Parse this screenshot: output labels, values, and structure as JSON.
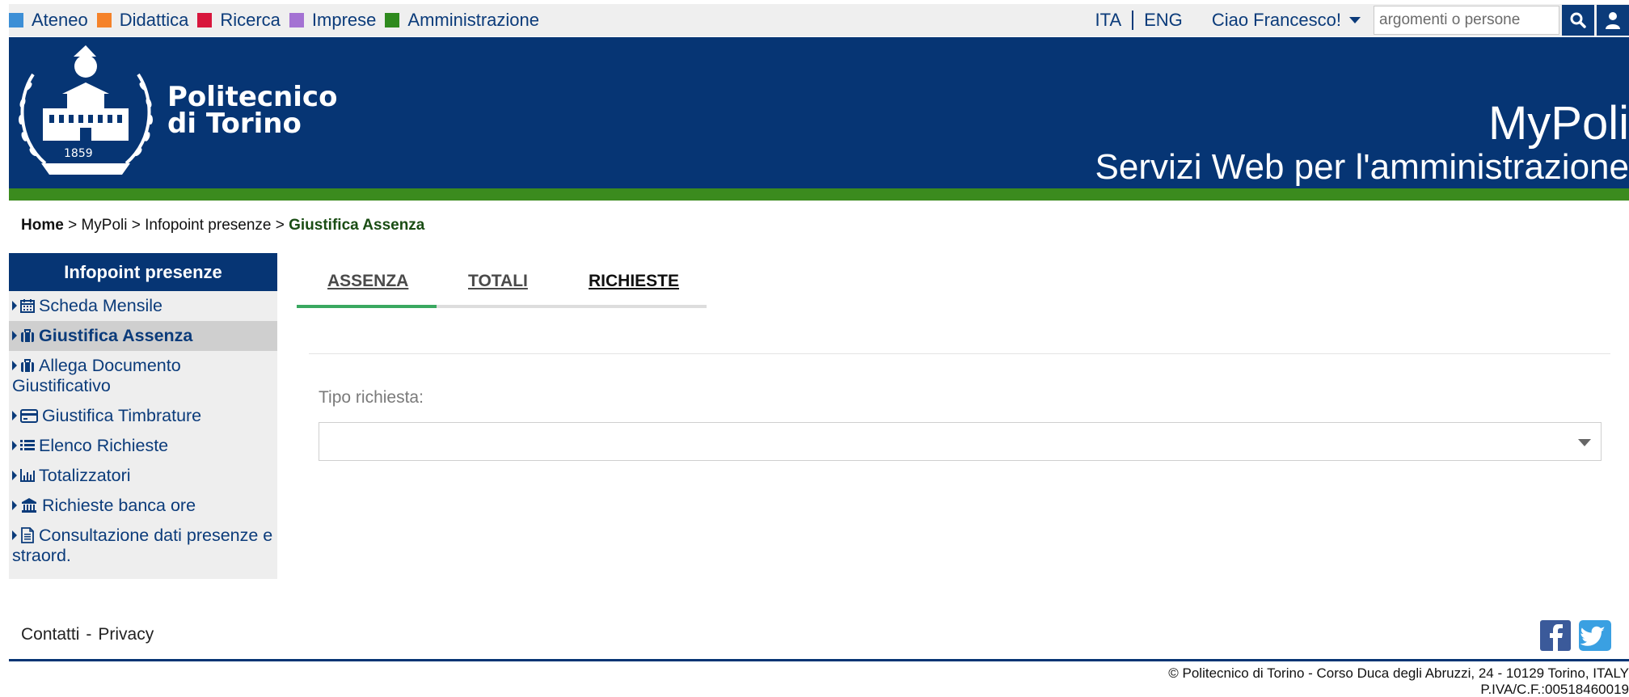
{
  "topnav": {
    "items": [
      {
        "label": "Ateneo",
        "color": "#3d8fd6"
      },
      {
        "label": "Didattica",
        "color": "#f5822a"
      },
      {
        "label": "Ricerca",
        "color": "#d8163c"
      },
      {
        "label": "Imprese",
        "color": "#a472d3"
      },
      {
        "label": "Amministrazione",
        "color": "#2f8a1e"
      }
    ],
    "lang_ita": "ITA",
    "lang_eng": "ENG",
    "user_greeting": "Ciao Francesco!",
    "search_placeholder": "argomenti o persone",
    "search_icon": "search-icon",
    "user_icon": "user-icon"
  },
  "header": {
    "logo_line1": "Politecnico",
    "logo_line2": "di Torino",
    "logo_year": "1859",
    "app_title": "MyPoli",
    "app_subtitle": "Servizi Web per l'amministrazione",
    "bg_color": "#063574",
    "accent_green": "#3b8b1e"
  },
  "breadcrumb": {
    "home": "Home",
    "sep": " > ",
    "level1": "MyPoli",
    "level2": "Infopoint presenze",
    "current": "Giustifica Assenza"
  },
  "sidebar": {
    "title": "Infopoint presenze",
    "items": [
      {
        "label": "Scheda Mensile",
        "icon": "calendar-icon"
      },
      {
        "label": "Giustifica Assenza",
        "icon": "briefcase-icon",
        "active": true
      },
      {
        "label": "Allega Documento Giustificativo",
        "icon": "briefcase-icon"
      },
      {
        "label": "Giustifica Timbrature",
        "icon": "credit-card-icon"
      },
      {
        "label": "Elenco Richieste",
        "icon": "list-icon"
      },
      {
        "label": "Totalizzatori",
        "icon": "bar-chart-icon"
      },
      {
        "label": "Richieste banca ore",
        "icon": "bank-icon"
      },
      {
        "label": "Consultazione dati presenze e straord.",
        "icon": "document-icon"
      }
    ]
  },
  "tabs": {
    "assenza": "ASSENZA",
    "totali": "TOTALI",
    "richieste": "RICHIESTE",
    "active": "ASSENZA"
  },
  "form": {
    "tipo_label": "Tipo richiesta:",
    "tipo_value": ""
  },
  "footer": {
    "contatti": "Contatti",
    "dash": "-",
    "privacy": "Privacy",
    "copyright": "© Politecnico di Torino - Corso Duca degli Abruzzi, 24 - 10129 Torino, ITALY",
    "piva": "P.IVA/C.F.:00518460019",
    "facebook_icon": "facebook-icon",
    "twitter_icon": "twitter-icon"
  }
}
